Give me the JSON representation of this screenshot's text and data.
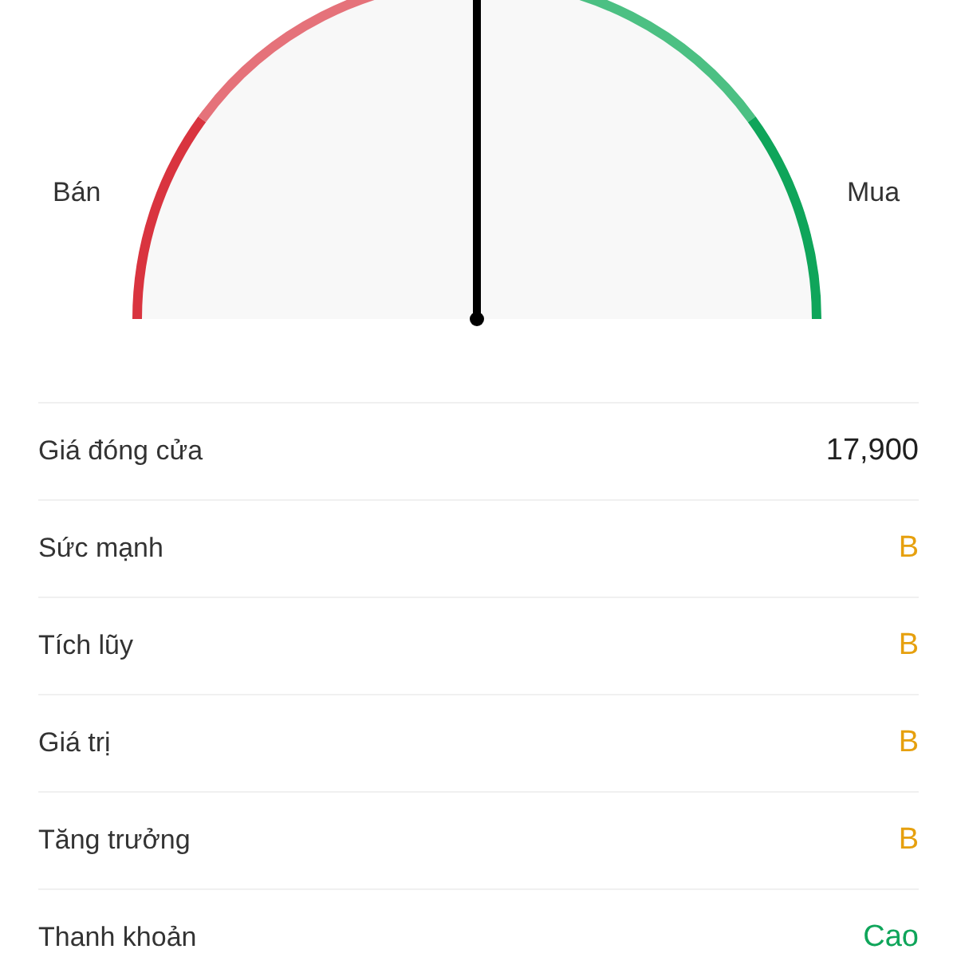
{
  "gauge": {
    "left_label": "Bán",
    "right_label": "Mua",
    "level": 0.5
  },
  "rows": [
    {
      "label": "Giá đóng cửa",
      "value": "17,900",
      "color": "#1f1f1f"
    },
    {
      "label": "Sức mạnh",
      "value": "B",
      "color": "#e6a00e"
    },
    {
      "label": "Tích lũy",
      "value": "B",
      "color": "#e6a00e"
    },
    {
      "label": "Giá trị",
      "value": "B",
      "color": "#e6a00e"
    },
    {
      "label": "Tăng trưởng",
      "value": "B",
      "color": "#e6a00e"
    },
    {
      "label": "Thanh khoản",
      "value": "Cao",
      "color": "#0fa55a"
    }
  ]
}
